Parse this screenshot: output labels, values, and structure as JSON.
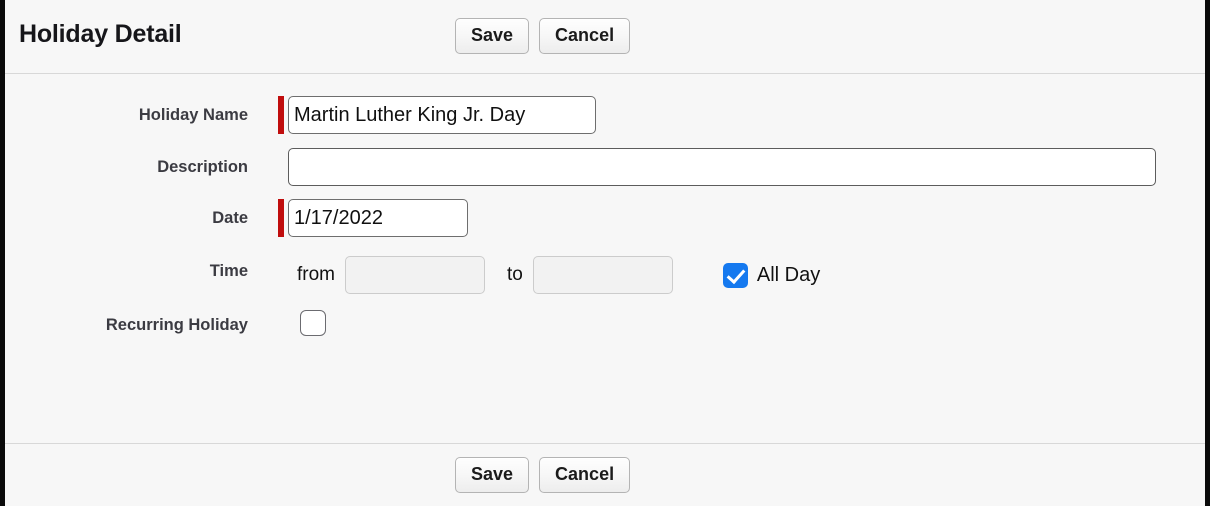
{
  "header": {
    "title": "Holiday Detail",
    "save_label": "Save",
    "cancel_label": "Cancel"
  },
  "form": {
    "holiday_name": {
      "label": "Holiday Name",
      "value": "Martin Luther King Jr. Day",
      "placeholder": "",
      "required": true
    },
    "description": {
      "label": "Description",
      "value": "",
      "placeholder": "",
      "required": false
    },
    "date": {
      "label": "Date",
      "value": "1/17/2022",
      "placeholder": "",
      "required": true
    },
    "time": {
      "label": "Time",
      "from_word": "from",
      "from_value": "",
      "to_word": "to",
      "to_value": "",
      "all_day_label": "All Day",
      "all_day_checked": true
    },
    "recurring_holiday": {
      "label": "Recurring Holiday",
      "checked": false
    }
  },
  "footer": {
    "save_label": "Save",
    "cancel_label": "Cancel"
  },
  "colors": {
    "required_marker": "#c00d0d",
    "checkbox_accent": "#1579ef",
    "label_text": "#3b3b42",
    "panel_background": "#f7f7f7"
  }
}
